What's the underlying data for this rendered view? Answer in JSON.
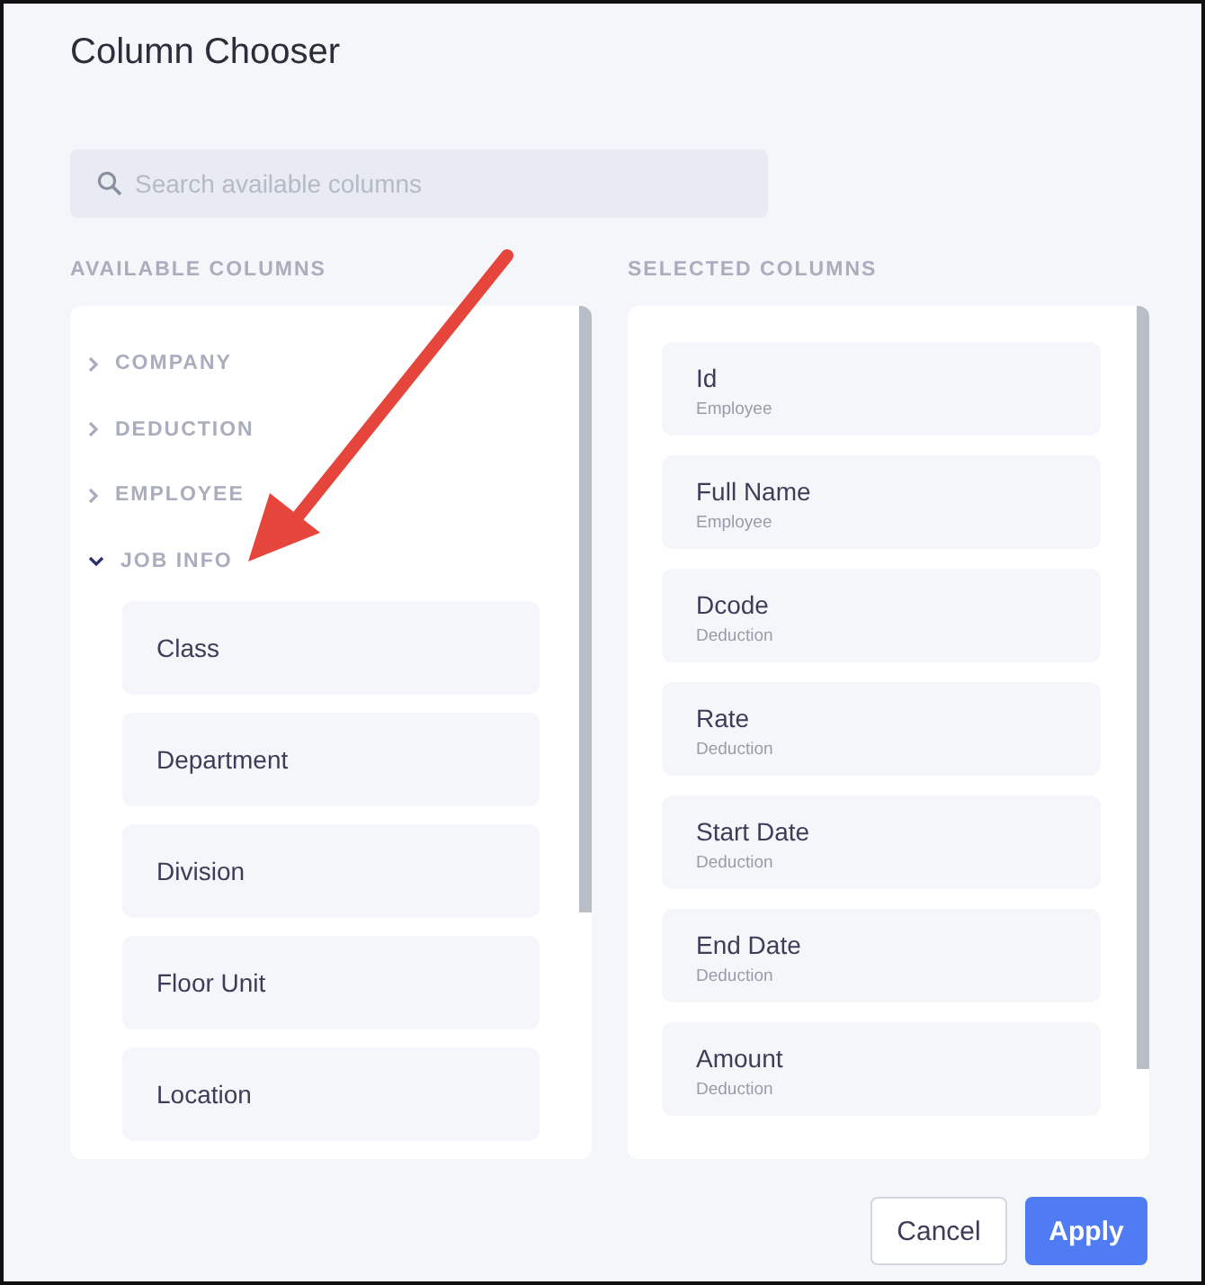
{
  "dialog": {
    "title": "Column Chooser"
  },
  "search": {
    "placeholder": "Search available columns"
  },
  "available": {
    "heading": "AVAILABLE COLUMNS",
    "groups": [
      {
        "label": "COMPANY",
        "expanded": false
      },
      {
        "label": "DEDUCTION",
        "expanded": false
      },
      {
        "label": "EMPLOYEE",
        "expanded": false
      },
      {
        "label": "JOB INFO",
        "expanded": true,
        "children": [
          {
            "label": "Class"
          },
          {
            "label": "Department"
          },
          {
            "label": "Division"
          },
          {
            "label": "Floor Unit"
          },
          {
            "label": "Location"
          }
        ]
      }
    ]
  },
  "selected": {
    "heading": "SELECTED COLUMNS",
    "items": [
      {
        "label": "Id",
        "group": "Employee"
      },
      {
        "label": "Full Name",
        "group": "Employee"
      },
      {
        "label": "Dcode",
        "group": "Deduction"
      },
      {
        "label": "Rate",
        "group": "Deduction"
      },
      {
        "label": "Start Date",
        "group": "Deduction"
      },
      {
        "label": "End Date",
        "group": "Deduction"
      },
      {
        "label": "Amount",
        "group": "Deduction"
      }
    ]
  },
  "buttons": [
    {
      "label": "Cancel",
      "kind": "secondary"
    },
    {
      "label": "Apply",
      "kind": "primary"
    }
  ]
}
